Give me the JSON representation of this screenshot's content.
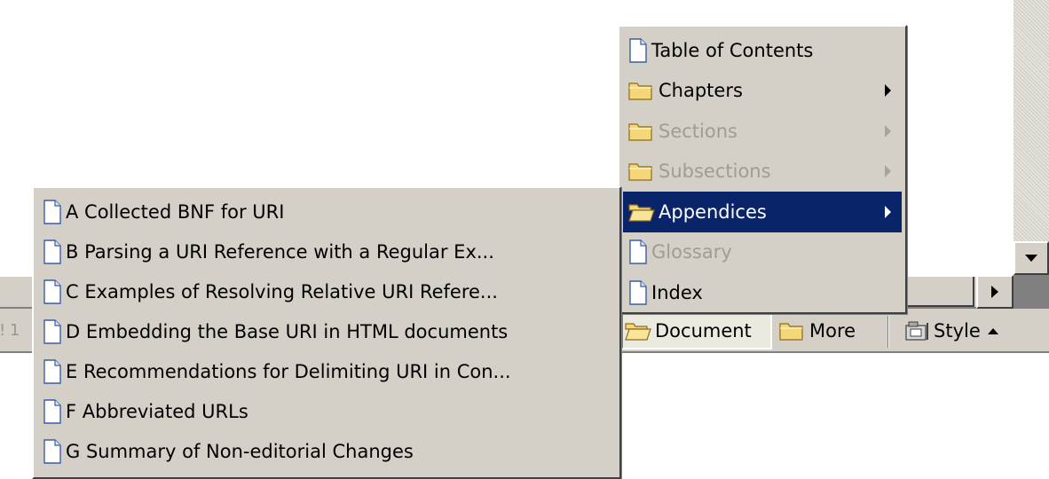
{
  "status_left_text": "ǃ 1",
  "toolbar": {
    "document_label": "Document",
    "more_label": "More",
    "style_label": "Style"
  },
  "main_menu": {
    "items": [
      {
        "label": "Table of Contents",
        "icon": "page-icon",
        "state": "normal",
        "submenu": false
      },
      {
        "label": "Chapters",
        "icon": "folder-icon",
        "state": "normal",
        "submenu": true
      },
      {
        "label": "Sections",
        "icon": "folder-icon",
        "state": "disabled",
        "submenu": true
      },
      {
        "label": "Subsections",
        "icon": "folder-icon",
        "state": "disabled",
        "submenu": true
      },
      {
        "label": "Appendices",
        "icon": "folder-open-icon",
        "state": "selected",
        "submenu": true
      },
      {
        "label": "Glossary",
        "icon": "page-icon",
        "state": "disabled",
        "submenu": false
      },
      {
        "label": "Index",
        "icon": "page-icon",
        "state": "normal",
        "submenu": false
      }
    ]
  },
  "appendices_menu": {
    "items": [
      {
        "label": "A Collected BNF for URI"
      },
      {
        "label": "B Parsing a URI Reference with a Regular Ex..."
      },
      {
        "label": "C Examples of Resolving Relative URI Refere..."
      },
      {
        "label": "D Embedding the Base URI in HTML documents"
      },
      {
        "label": "E Recommendations for Delimiting URI in Con..."
      },
      {
        "label": "F Abbreviated URLs"
      },
      {
        "label": "G Summary of Non-editorial Changes"
      }
    ]
  },
  "colors": {
    "menu_bg": "#d4d0c8",
    "highlight": "#0a246a",
    "disabled_text": "#a09c94",
    "folder": "#f5d77a"
  }
}
